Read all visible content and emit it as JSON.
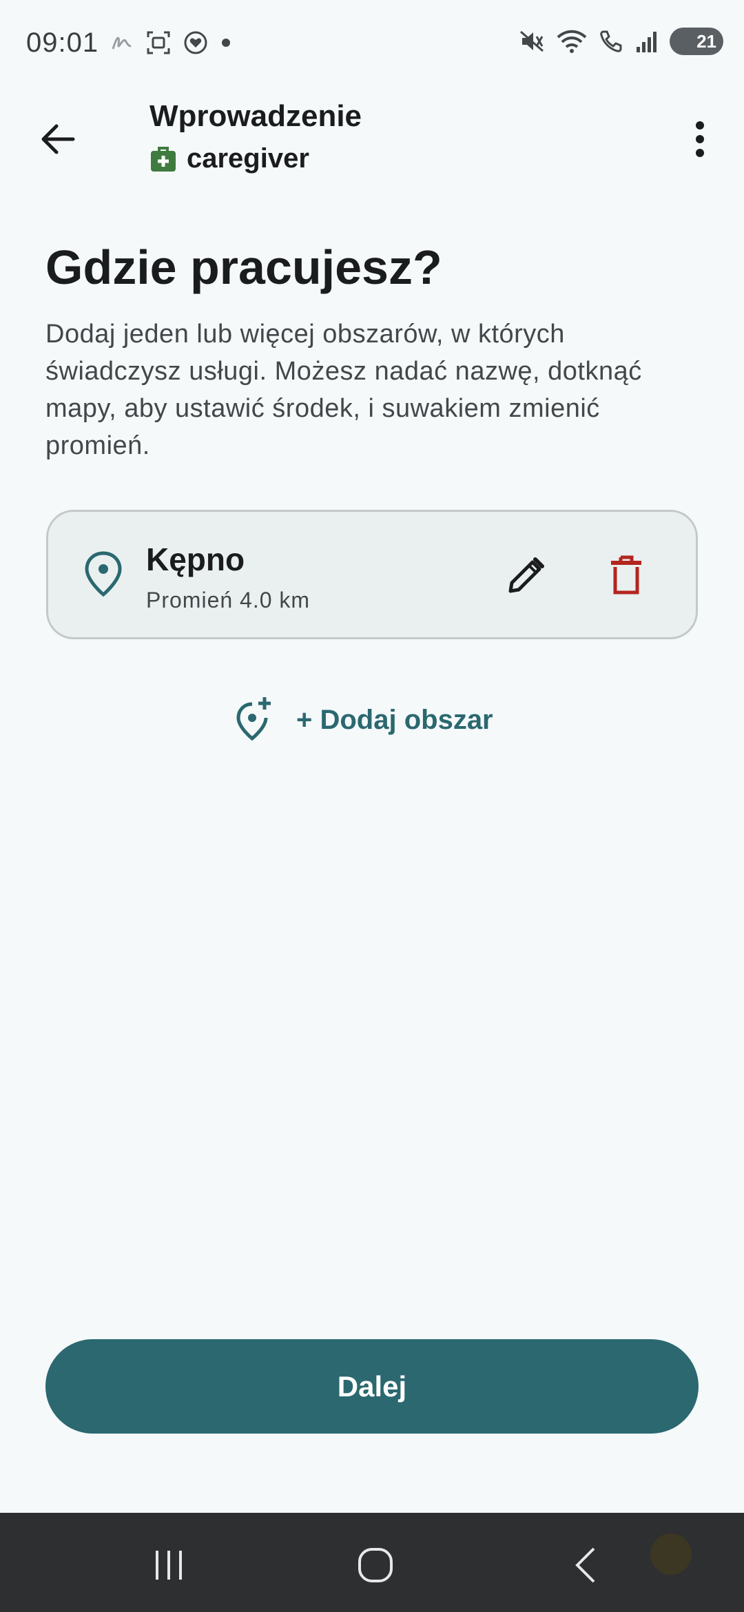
{
  "status_bar": {
    "time": "09:01",
    "battery": "21"
  },
  "app_bar": {
    "title": "Wprowadzenie",
    "role": "caregiver"
  },
  "content": {
    "heading": "Gdzie pracujesz?",
    "description": "Dodaj jeden lub więcej obszarów, w których świadczysz usługi. Możesz nadać nazwę, dotknąć mapy, aby ustawić środek, i suwakiem zmienić promień."
  },
  "areas": [
    {
      "name": "Kępno",
      "radius": "Promień 4.0 km",
      "icon": "location-pin-icon"
    }
  ],
  "actions": {
    "add_area": "+ Dodaj obszar",
    "next": "Dalej"
  },
  "colors": {
    "primary": "#2b6870",
    "background": "#f5f9fa",
    "card": "#eaf0f0",
    "delete": "#b3261e",
    "role_badge": "#3f7b3f"
  }
}
